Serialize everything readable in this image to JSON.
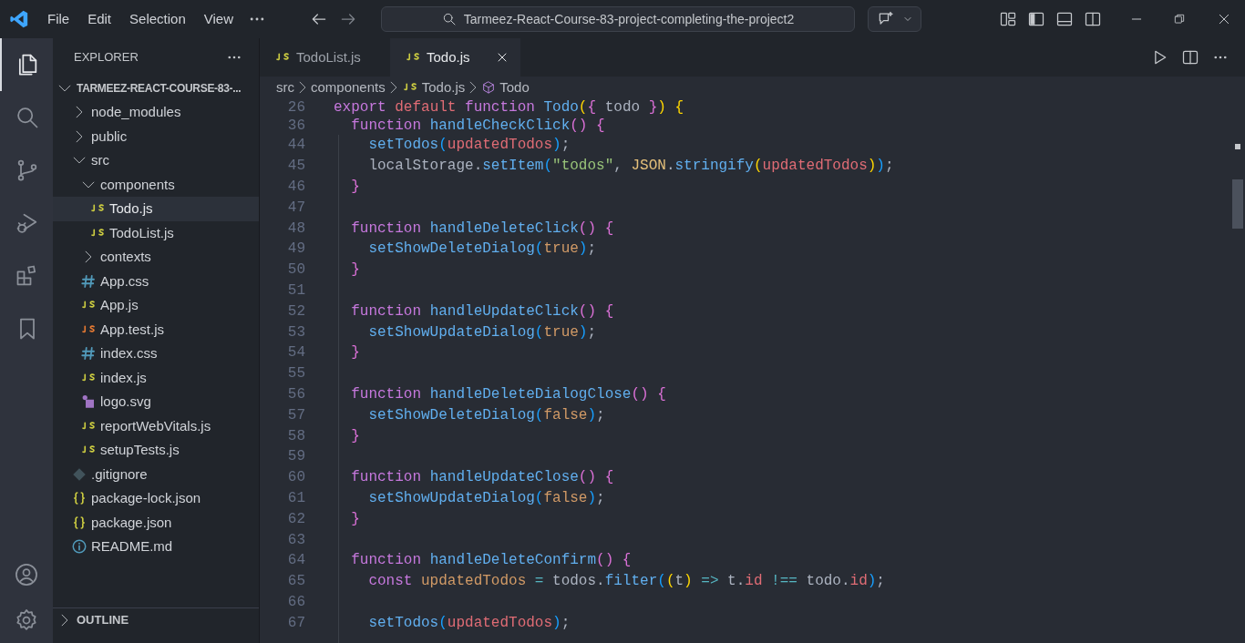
{
  "titlebar": {
    "menu": [
      "File",
      "Edit",
      "Selection",
      "View"
    ],
    "search": {
      "value": "Tarmeez-React-Course-83-project-completing-the-project2"
    }
  },
  "activity_bar": {
    "items": [
      {
        "kind": "files",
        "selected": true
      },
      {
        "kind": "search",
        "selected": false
      },
      {
        "kind": "source-control",
        "selected": false
      },
      {
        "kind": "run-debug",
        "selected": false
      },
      {
        "kind": "extensions",
        "selected": false
      },
      {
        "kind": "bookmark",
        "selected": false
      }
    ],
    "bottom": [
      {
        "kind": "account"
      },
      {
        "kind": "settings"
      }
    ]
  },
  "explorer": {
    "title": "EXPLORER",
    "root": {
      "label": "TARMEEZ-REACT-COURSE-83-...",
      "expanded": true,
      "children": [
        {
          "label": "node_modules",
          "kind": "folder",
          "expanded": false
        },
        {
          "label": "public",
          "kind": "folder",
          "expanded": false
        },
        {
          "label": "src",
          "kind": "folder",
          "expanded": true,
          "children": [
            {
              "label": "components",
              "kind": "folder",
              "expanded": true,
              "children": [
                {
                  "label": "Todo.js",
                  "kind": "js",
                  "selected": true
                },
                {
                  "label": "TodoList.js",
                  "kind": "js",
                  "selected": false
                }
              ]
            },
            {
              "label": "contexts",
              "kind": "folder",
              "expanded": false
            },
            {
              "label": "App.css",
              "kind": "css",
              "selected": false
            },
            {
              "label": "App.js",
              "kind": "js",
              "selected": false
            },
            {
              "label": "App.test.js",
              "kind": "test",
              "selected": false
            },
            {
              "label": "index.css",
              "kind": "css",
              "selected": false
            },
            {
              "label": "index.js",
              "kind": "js",
              "selected": false
            },
            {
              "label": "logo.svg",
              "kind": "svg",
              "selected": false
            },
            {
              "label": "reportWebVitals.js",
              "kind": "js",
              "selected": false
            },
            {
              "label": "setupTests.js",
              "kind": "js",
              "selected": false
            }
          ]
        },
        {
          "label": ".gitignore",
          "kind": "git",
          "selected": false
        },
        {
          "label": "package-lock.json",
          "kind": "json",
          "selected": false
        },
        {
          "label": "package.json",
          "kind": "json",
          "selected": false
        },
        {
          "label": "README.md",
          "kind": "info",
          "selected": false
        }
      ]
    },
    "sections": [
      {
        "label": "OUTLINE",
        "expanded": false
      }
    ]
  },
  "tabs": [
    {
      "label": "TodoList.js",
      "selected": false
    },
    {
      "label": "Todo.js",
      "selected": true
    }
  ],
  "breadcrumb": [
    {
      "label": "src",
      "kind": "folder"
    },
    {
      "label": "components",
      "kind": "folder"
    },
    {
      "label": "Todo.js",
      "kind": "file"
    },
    {
      "label": "Todo",
      "kind": "symbol"
    }
  ],
  "sticky_lines": [
    {
      "number": "26",
      "tokens": [
        {
          "text": "export ",
          "kind": "keyword"
        },
        {
          "text": "default ",
          "kind": "modifier"
        },
        {
          "text": "function ",
          "kind": "keyword"
        },
        {
          "text": "Todo",
          "kind": "function"
        },
        {
          "text": "(",
          "kind": "bracket1"
        },
        {
          "text": "{",
          "kind": "bracket2"
        },
        {
          "text": " todo ",
          "kind": "plain"
        },
        {
          "text": "}",
          "kind": "bracket2"
        },
        {
          "text": ")",
          "kind": "bracket1"
        },
        {
          "text": " {",
          "kind": "bracket1"
        }
      ]
    },
    {
      "number": "36",
      "tokens": [
        {
          "text": "  function ",
          "kind": "keyword"
        },
        {
          "text": "handleCheckClick",
          "kind": "function"
        },
        {
          "text": "() {",
          "kind": "bracket2"
        }
      ]
    }
  ],
  "lines": [
    {
      "number": "44",
      "tokens": [
        {
          "text": "    setTodos",
          "kind": "function"
        },
        {
          "text": "(",
          "kind": "bracket3"
        },
        {
          "text": "updatedTodos",
          "kind": "variable"
        },
        {
          "text": ")",
          "kind": "bracket3"
        },
        {
          "text": ";",
          "kind": "plain"
        }
      ]
    },
    {
      "number": "45",
      "tokens": [
        {
          "text": "    localStorage.",
          "kind": "plain"
        },
        {
          "text": "setItem",
          "kind": "function"
        },
        {
          "text": "(",
          "kind": "bracket3"
        },
        {
          "text": "\"todos\"",
          "kind": "string"
        },
        {
          "text": ", ",
          "kind": "plain"
        },
        {
          "text": "JSON",
          "kind": "class"
        },
        {
          "text": ".",
          "kind": "plain"
        },
        {
          "text": "stringify",
          "kind": "function"
        },
        {
          "text": "(",
          "kind": "bracket1"
        },
        {
          "text": "updatedTodos",
          "kind": "variable"
        },
        {
          "text": ")",
          "kind": "bracket1"
        },
        {
          "text": ")",
          "kind": "bracket3"
        },
        {
          "text": ";",
          "kind": "plain"
        }
      ]
    },
    {
      "number": "46",
      "tokens": [
        {
          "text": "  }",
          "kind": "bracket2"
        }
      ]
    },
    {
      "number": "47"
    },
    {
      "number": "48",
      "tokens": [
        {
          "text": "  function ",
          "kind": "keyword"
        },
        {
          "text": "handleDeleteClick",
          "kind": "function"
        },
        {
          "text": "() {",
          "kind": "bracket2"
        }
      ]
    },
    {
      "number": "49",
      "tokens": [
        {
          "text": "    setShowDeleteDialog",
          "kind": "function"
        },
        {
          "text": "(",
          "kind": "bracket3"
        },
        {
          "text": "true",
          "kind": "literal"
        },
        {
          "text": ")",
          "kind": "bracket3"
        },
        {
          "text": ";",
          "kind": "plain"
        }
      ]
    },
    {
      "number": "50",
      "tokens": [
        {
          "text": "  }",
          "kind": "bracket2"
        }
      ]
    },
    {
      "number": "51"
    },
    {
      "number": "52",
      "tokens": [
        {
          "text": "  function ",
          "kind": "keyword"
        },
        {
          "text": "handleUpdateClick",
          "kind": "function"
        },
        {
          "text": "() {",
          "kind": "bracket2"
        }
      ]
    },
    {
      "number": "53",
      "tokens": [
        {
          "text": "    setShowUpdateDialog",
          "kind": "function"
        },
        {
          "text": "(",
          "kind": "bracket3"
        },
        {
          "text": "true",
          "kind": "literal"
        },
        {
          "text": ")",
          "kind": "bracket3"
        },
        {
          "text": ";",
          "kind": "plain"
        }
      ]
    },
    {
      "number": "54",
      "tokens": [
        {
          "text": "  }",
          "kind": "bracket2"
        }
      ]
    },
    {
      "number": "55"
    },
    {
      "number": "56",
      "tokens": [
        {
          "text": "  function ",
          "kind": "keyword"
        },
        {
          "text": "handleDeleteDialogClose",
          "kind": "function"
        },
        {
          "text": "() {",
          "kind": "bracket2"
        }
      ]
    },
    {
      "number": "57",
      "tokens": [
        {
          "text": "    setShowDeleteDialog",
          "kind": "function"
        },
        {
          "text": "(",
          "kind": "bracket3"
        },
        {
          "text": "false",
          "kind": "literal"
        },
        {
          "text": ")",
          "kind": "bracket3"
        },
        {
          "text": ";",
          "kind": "plain"
        }
      ]
    },
    {
      "number": "58",
      "tokens": [
        {
          "text": "  }",
          "kind": "bracket2"
        }
      ]
    },
    {
      "number": "59"
    },
    {
      "number": "60",
      "tokens": [
        {
          "text": "  function ",
          "kind": "keyword"
        },
        {
          "text": "handleUpdateClose",
          "kind": "function"
        },
        {
          "text": "() {",
          "kind": "bracket2"
        }
      ]
    },
    {
      "number": "61",
      "tokens": [
        {
          "text": "    setShowUpdateDialog",
          "kind": "function"
        },
        {
          "text": "(",
          "kind": "bracket3"
        },
        {
          "text": "false",
          "kind": "literal"
        },
        {
          "text": ")",
          "kind": "bracket3"
        },
        {
          "text": ";",
          "kind": "plain"
        }
      ]
    },
    {
      "number": "62",
      "tokens": [
        {
          "text": "  }",
          "kind": "bracket2"
        }
      ]
    },
    {
      "number": "63"
    },
    {
      "number": "64",
      "tokens": [
        {
          "text": "  function ",
          "kind": "keyword"
        },
        {
          "text": "handleDeleteConfirm",
          "kind": "function"
        },
        {
          "text": "() {",
          "kind": "bracket2"
        }
      ]
    },
    {
      "number": "65",
      "tokens": [
        {
          "text": "    const ",
          "kind": "keyword"
        },
        {
          "text": "updatedTodos",
          "kind": "literal"
        },
        {
          "text": " = ",
          "kind": "operator"
        },
        {
          "text": "todos.",
          "kind": "plain"
        },
        {
          "text": "filter",
          "kind": "function"
        },
        {
          "text": "(",
          "kind": "bracket3"
        },
        {
          "text": "(",
          "kind": "bracket1"
        },
        {
          "text": "t",
          "kind": "plain"
        },
        {
          "text": ")",
          "kind": "bracket1"
        },
        {
          "text": " => ",
          "kind": "operator"
        },
        {
          "text": "t.",
          "kind": "plain"
        },
        {
          "text": "id",
          "kind": "variable"
        },
        {
          "text": " !== ",
          "kind": "operator"
        },
        {
          "text": "todo.",
          "kind": "plain"
        },
        {
          "text": "id",
          "kind": "variable"
        },
        {
          "text": ")",
          "kind": "bracket3"
        },
        {
          "text": ";",
          "kind": "plain"
        }
      ]
    },
    {
      "number": "66"
    },
    {
      "number": "67",
      "tokens": [
        {
          "text": "    setTodos",
          "kind": "function"
        },
        {
          "text": "(",
          "kind": "bracket3"
        },
        {
          "text": "updatedTodos",
          "kind": "variable"
        },
        {
          "text": ")",
          "kind": "bracket3"
        },
        {
          "text": ";",
          "kind": "plain"
        }
      ]
    }
  ]
}
